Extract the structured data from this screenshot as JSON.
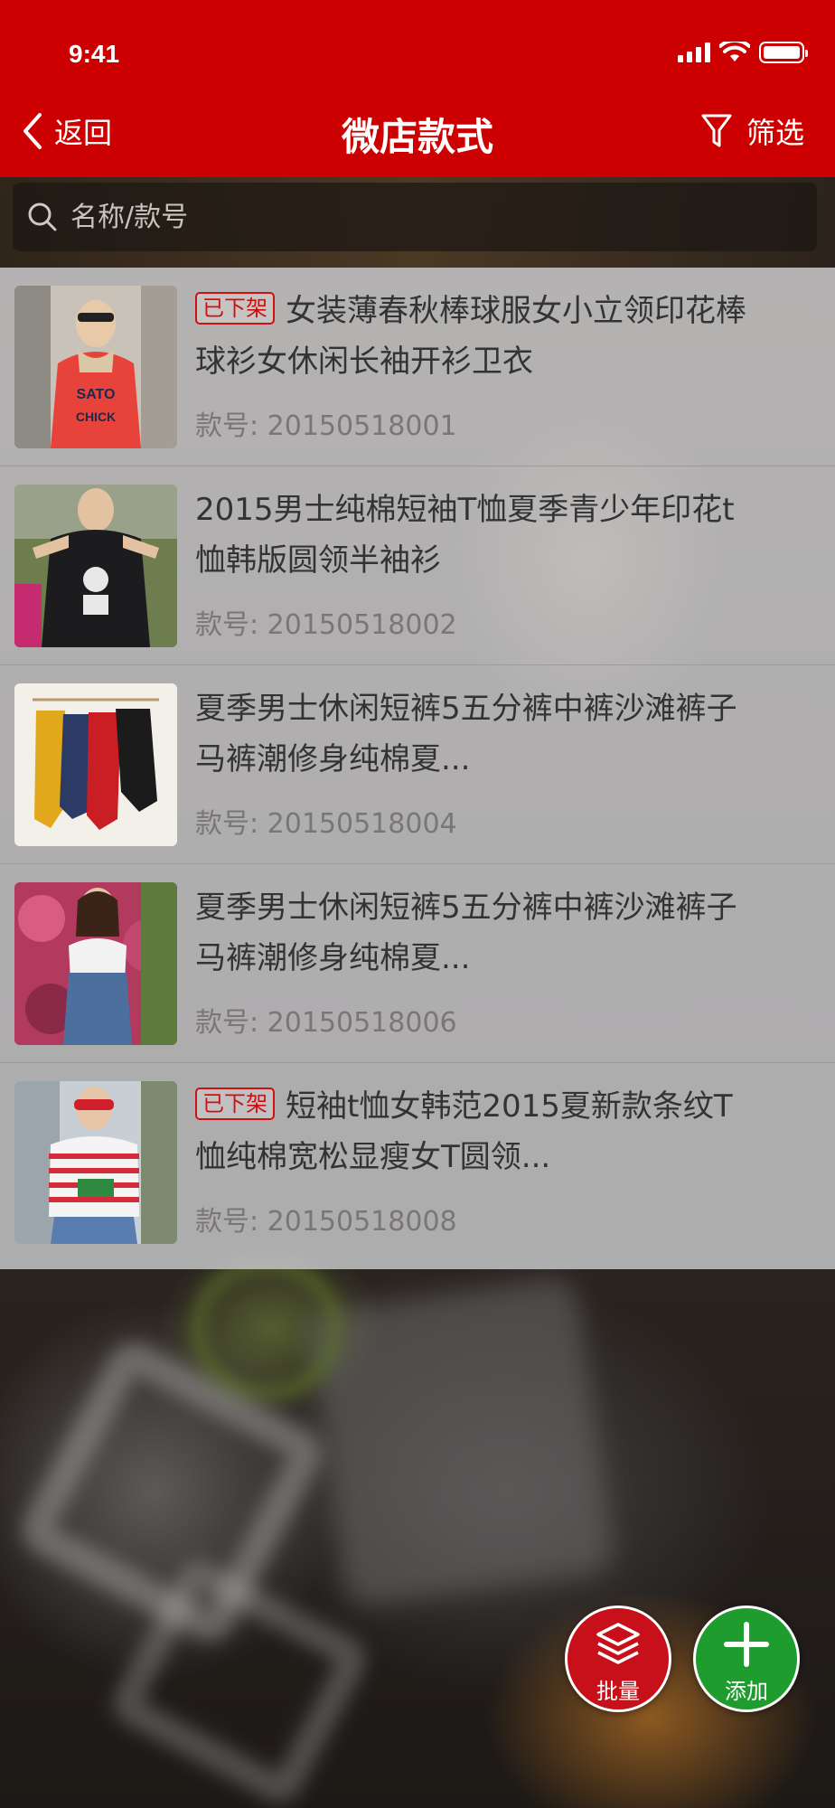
{
  "status_bar": {
    "time": "9:41"
  },
  "nav": {
    "back_label": "返回",
    "title": "微店款式",
    "filter_label": "筛选"
  },
  "search": {
    "placeholder": "名称/款号"
  },
  "products": [
    {
      "status_badge": "已下架",
      "title": "女装薄春秋棒球服女小立领印花棒球衫女休闲长袖开衫卫衣",
      "code_label": "款号:",
      "code": "20150518001"
    },
    {
      "status_badge": "",
      "title": "2015男士纯棉短袖T恤夏季青少年印花t恤韩版圆领半袖衫",
      "code_label": "款号:",
      "code": "20150518002"
    },
    {
      "status_badge": "",
      "title": "夏季男士休闲短裤5五分裤中裤沙滩裤子马裤潮修身纯棉夏...",
      "code_label": "款号:",
      "code": "20150518004"
    },
    {
      "status_badge": "",
      "title": "夏季男士休闲短裤5五分裤中裤沙滩裤子马裤潮修身纯棉夏...",
      "code_label": "款号:",
      "code": "20150518006"
    },
    {
      "status_badge": "已下架",
      "title": "短袖t恤女韩范2015夏新款条纹T恤纯棉宽松显瘦女T圆领...",
      "code_label": "款号:",
      "code": "20150518008"
    }
  ],
  "actions": {
    "batch_label": "批量",
    "add_label": "添加"
  },
  "colors": {
    "header_red": "#cc0000",
    "badge_red": "#d01010",
    "batch_red": "#c8101a",
    "add_green": "#1f9c2e"
  }
}
